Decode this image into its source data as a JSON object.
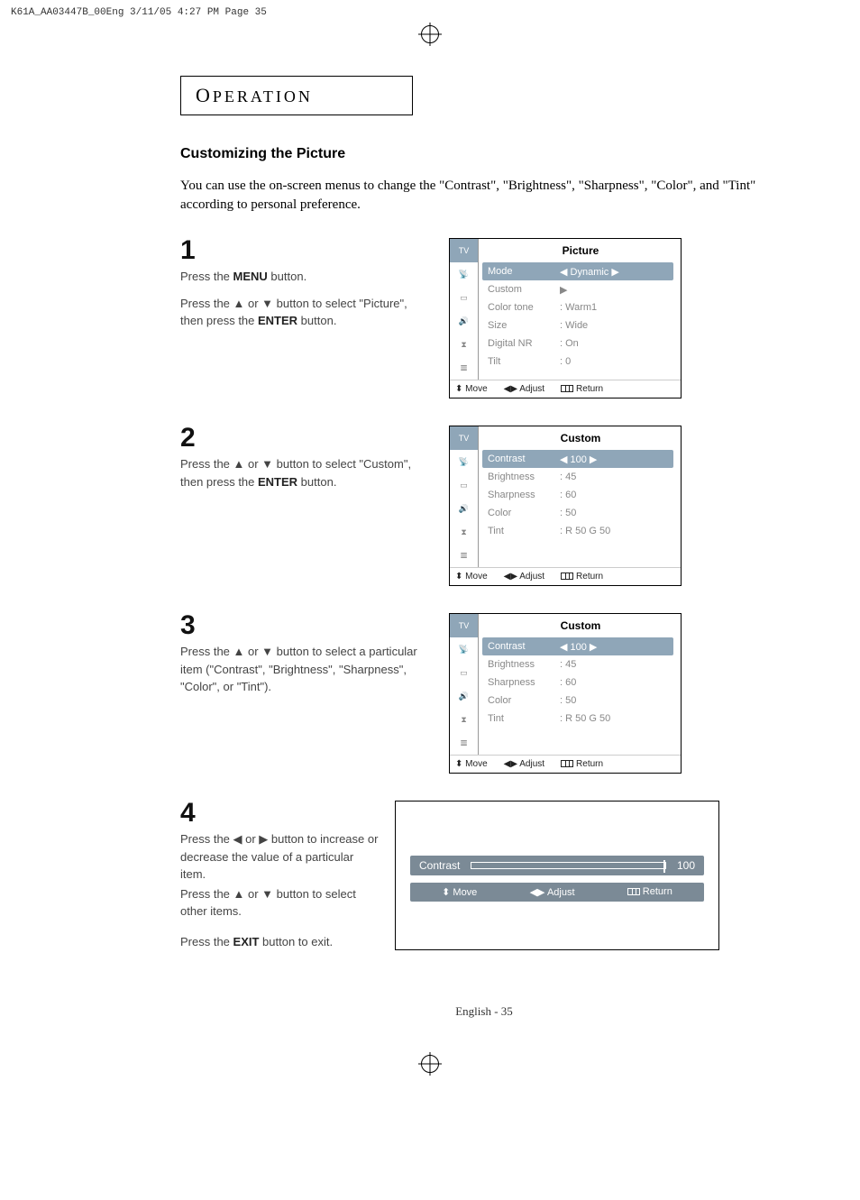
{
  "print_meta": "K61A_AA03447B_00Eng  3/11/05  4:27 PM  Page 35",
  "section_letters": {
    "cap": "O",
    "rest": "PERATION"
  },
  "heading": "Customizing the Picture",
  "intro": "You can use the on-screen menus to change the \"Contrast\", \"Brightness\", \"Sharpness\", \"Color\", and \"Tint\" according to personal preference.",
  "steps": [
    {
      "num": "1",
      "instr_a": "Press the <b>MENU</b> button.",
      "instr_b": "Press the ▲ or ▼ button to select \"Picture\", then press the <b>ENTER</b> button."
    },
    {
      "num": "2",
      "instr_a": "Press the ▲ or ▼ button to select \"Custom\", then press the <b>ENTER</b> button."
    },
    {
      "num": "3",
      "instr_a": "Press the ▲ or ▼ button to select a particular item (\"Contrast\", \"Brightness\", \"Sharpness\", \"Color\", or \"Tint\")."
    },
    {
      "num": "4",
      "instr_a": "Press the ◀ or ▶ button to increase or decrease the value of a particular item.",
      "instr_b": "Press the ▲ or ▼ button to select other items.",
      "instr_c": "Press the <b>EXIT</b> button to exit."
    }
  ],
  "osd1": {
    "title": "Picture",
    "rows": [
      {
        "lbl": "Mode",
        "val": "◀  Dynamic  ▶",
        "sel": true
      },
      {
        "lbl": "Custom",
        "val": "▶"
      },
      {
        "lbl": "Color tone",
        "val": ": Warm1"
      },
      {
        "lbl": "Size",
        "val": ":  Wide"
      },
      {
        "lbl": "Digital NR",
        "val": ":  On"
      },
      {
        "lbl": "Tilt",
        "val": ":    0"
      }
    ]
  },
  "osd2": {
    "title": "Custom",
    "rows": [
      {
        "lbl": "Contrast",
        "val": "◀  100        ▶",
        "sel": true
      },
      {
        "lbl": "Brightness",
        "val": ":    45"
      },
      {
        "lbl": "Sharpness",
        "val": ":    60"
      },
      {
        "lbl": "Color",
        "val": ":    50"
      },
      {
        "lbl": "Tint",
        "val": ": R  50  G   50"
      }
    ]
  },
  "osd3": {
    "title": "Custom",
    "rows": [
      {
        "lbl": "Contrast",
        "val": "◀  100        ▶",
        "sel": true
      },
      {
        "lbl": "Brightness",
        "val": ":    45"
      },
      {
        "lbl": "Sharpness",
        "val": ":    60"
      },
      {
        "lbl": "Color",
        "val": ":    50"
      },
      {
        "lbl": "Tint",
        "val": ": R  50  G   50"
      }
    ]
  },
  "osd_foot": {
    "move": "Move",
    "adjust": "Adjust",
    "return": "Return"
  },
  "slider": {
    "label": "Contrast",
    "value": "100",
    "move": "Move",
    "adjust": "Adjust",
    "return": "Return"
  },
  "tab_label": "TV",
  "footer": "English - 35"
}
